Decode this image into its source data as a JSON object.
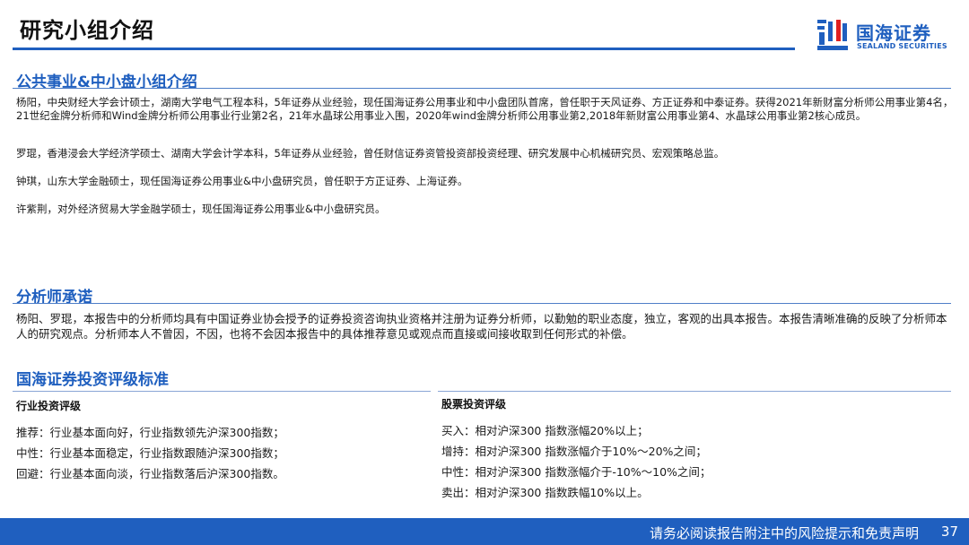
{
  "header": {
    "title": "研究小组介绍",
    "logo_cn": "国海证券",
    "logo_en": "SEALAND SECURITIES"
  },
  "sections": {
    "team": {
      "heading": "公共事业&中小盘小组介绍",
      "paragraphs": [
        "杨阳，中央财经大学会计硕士，湖南大学电气工程本科，5年证券从业经验，现任国海证券公用事业和中小盘团队首席，曾任职于天风证券、方正证券和中泰证券。获得2021年新财富分析师公用事业第4名，21世纪金牌分析师和Wind金牌分析师公用事业行业第2名，21年水晶球公用事业入围，2020年wind金牌分析师公用事业第2,2018年新财富公用事业第4、水晶球公用事业第2核心成员。",
        "罗琨，香港浸会大学经济学硕士、湖南大学会计学本科，5年证券从业经验，曾任财信证券资管投资部投资经理、研究发展中心机械研究员、宏观策略总监。",
        "钟琪，山东大学金融硕士，现任国海证券公用事业&中小盘研究员，曾任职于方正证券、上海证券。",
        "许紫荆，对外经济贸易大学金融学硕士，现任国海证券公用事业&中小盘研究员。"
      ]
    },
    "commitment": {
      "heading": "分析师承诺",
      "text": "杨阳、罗琨，本报告中的分析师均具有中国证券业协会授予的证券投资咨询执业资格并注册为证券分析师，以勤勉的职业态度，独立，客观的出具本报告。本报告清晰准确的反映了分析师本人的研究观点。分析师本人不曾因，不因，也将不会因本报告中的具体推荐意见或观点而直接或间接收取到任何形式的补偿。"
    },
    "rating": {
      "heading": "国海证券投资评级标准",
      "industry": {
        "title": "行业投资评级",
        "lines": [
          "推荐：行业基本面向好，行业指数领先沪深300指数；",
          "中性：行业基本面稳定，行业指数跟随沪深300指数；",
          "回避：行业基本面向淡，行业指数落后沪深300指数。"
        ]
      },
      "stock": {
        "title": "股票投资评级",
        "lines": [
          "买入：相对沪深300 指数涨幅20%以上；",
          "增持：相对沪深300 指数涨幅介于10%～20%之间；",
          "中性：相对沪深300 指数涨幅介于-10%～10%之间；",
          "卖出：相对沪深300 指数跌幅10%以上。"
        ]
      }
    }
  },
  "footer": {
    "disclaimer": "请务必阅读报告附注中的风险提示和免责声明",
    "page": "37"
  },
  "colors": {
    "brand_blue": "#1f5fbf",
    "logo_red": "#e02020"
  }
}
